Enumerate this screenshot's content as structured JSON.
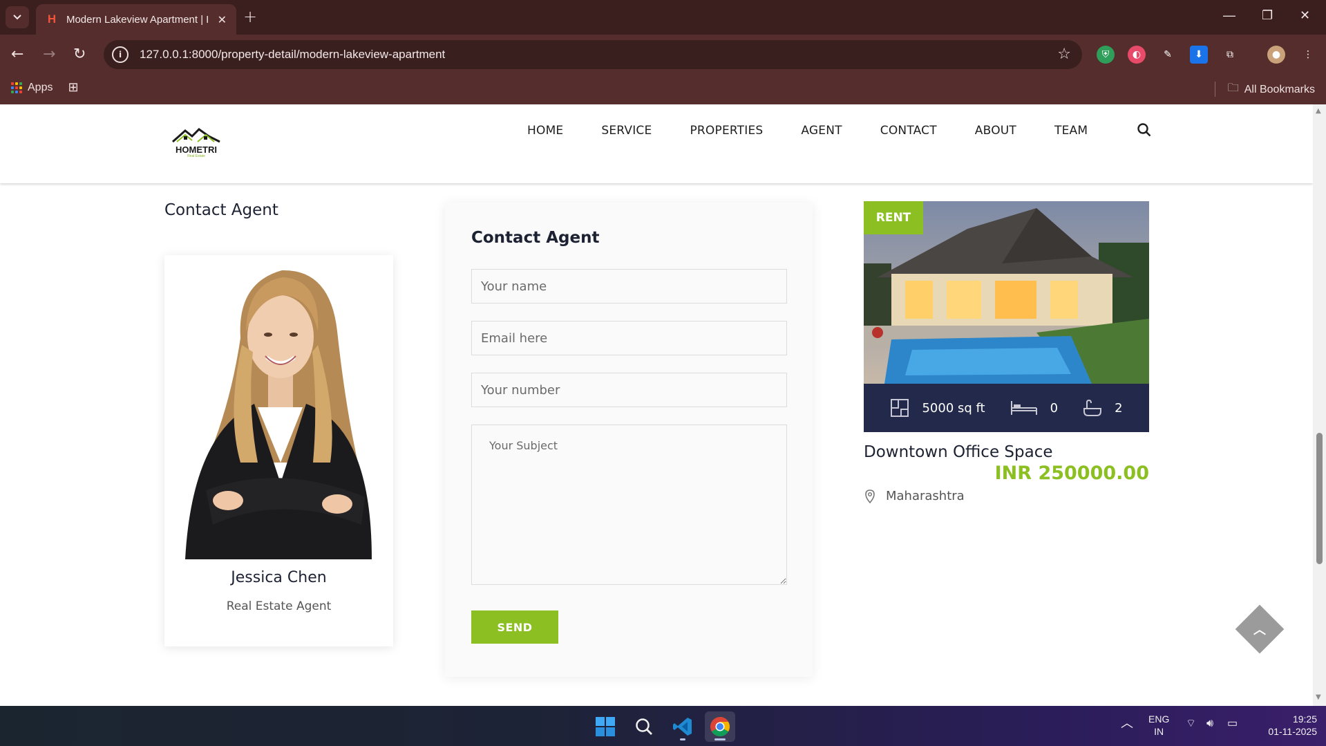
{
  "browser": {
    "tab_title": "Modern Lakeview Apartment | H",
    "url": "127.0.0.1:8000/property-detail/modern-lakeview-apartment",
    "bookmarks": {
      "apps_label": "Apps",
      "all_bookmarks_label": "All Bookmarks"
    }
  },
  "site": {
    "logo_text": "HOMETRI",
    "logo_sub": "Real Estate",
    "nav": [
      "HOME",
      "SERVICE",
      "PROPERTIES",
      "AGENT",
      "CONTACT",
      "ABOUT",
      "TEAM"
    ]
  },
  "agent_section": {
    "title": "Contact Agent",
    "name": "Jessica Chen",
    "role": "Real Estate Agent"
  },
  "contact_form": {
    "title": "Contact Agent",
    "name_placeholder": "Your name",
    "email_placeholder": "Email here",
    "number_placeholder": "Your number",
    "subject_placeholder": "Your Subject",
    "send_label": "SEND"
  },
  "property": {
    "badge": "RENT",
    "area": "5000 sq ft",
    "bedrooms": "0",
    "bathrooms": "2",
    "title": "Downtown Office Space",
    "price": "INR 250000.00",
    "location": "Maharashtra"
  },
  "taskbar": {
    "lang_top": "ENG",
    "lang_bottom": "IN",
    "time": "19:25",
    "date": "01-11-2025"
  },
  "colors": {
    "accent": "#8cbf22",
    "navy": "#23294a",
    "chrome": "#552d2d"
  }
}
